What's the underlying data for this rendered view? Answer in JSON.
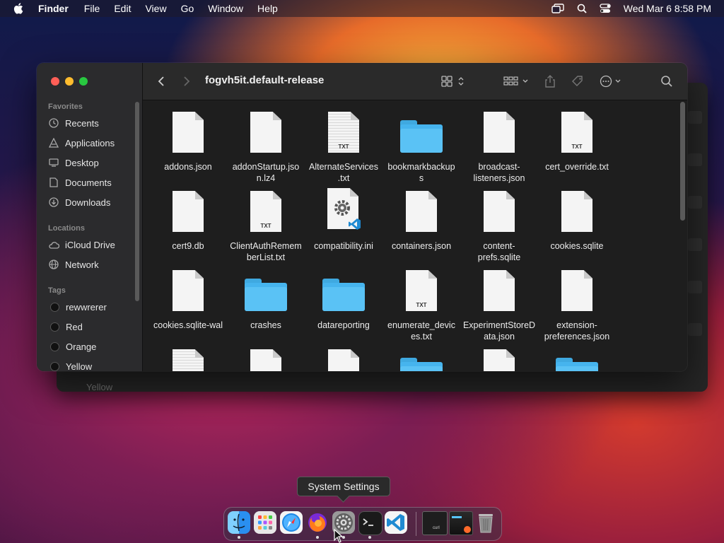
{
  "menubar": {
    "app_name": "Finder",
    "menus": [
      "File",
      "Edit",
      "View",
      "Go",
      "Window",
      "Help"
    ],
    "clock": "Wed Mar 6  8:58 PM"
  },
  "finder": {
    "title": "fogvh5it.default-release",
    "sidebar": {
      "favorites_title": "Favorites",
      "favorites": [
        {
          "label": "Recents",
          "icon": "clock-icon"
        },
        {
          "label": "Applications",
          "icon": "applications-icon"
        },
        {
          "label": "Desktop",
          "icon": "desktop-icon"
        },
        {
          "label": "Documents",
          "icon": "document-icon"
        },
        {
          "label": "Downloads",
          "icon": "download-icon"
        }
      ],
      "locations_title": "Locations",
      "locations": [
        {
          "label": "iCloud Drive",
          "icon": "cloud-icon"
        },
        {
          "label": "Network",
          "icon": "globe-icon"
        }
      ],
      "tags_title": "Tags",
      "tags": [
        {
          "label": "rewwrerer"
        },
        {
          "label": "Red"
        },
        {
          "label": "Orange"
        },
        {
          "label": "Yellow"
        }
      ]
    },
    "files": [
      {
        "name": "addons.json",
        "kind": "doc"
      },
      {
        "name": "addonStartup.jso\nn.lz4",
        "kind": "doc"
      },
      {
        "name": "AlternateServices\n.txt",
        "kind": "txt-lined"
      },
      {
        "name": "bookmarkbackup\ns",
        "kind": "folder"
      },
      {
        "name": "broadcast-\nlisteners.json",
        "kind": "doc"
      },
      {
        "name": "cert_override.txt",
        "kind": "txt"
      },
      {
        "name": "cert9.db",
        "kind": "doc"
      },
      {
        "name": "ClientAuthRemem\nberList.txt",
        "kind": "txt"
      },
      {
        "name": "compatibility.ini",
        "kind": "settings"
      },
      {
        "name": "containers.json",
        "kind": "doc"
      },
      {
        "name": "content-\nprefs.sqlite",
        "kind": "doc"
      },
      {
        "name": "cookies.sqlite",
        "kind": "doc"
      },
      {
        "name": "cookies.sqlite-wal",
        "kind": "doc"
      },
      {
        "name": "crashes",
        "kind": "folder"
      },
      {
        "name": "datareporting",
        "kind": "folder"
      },
      {
        "name": "enumerate_devic\nes.txt",
        "kind": "txt"
      },
      {
        "name": "ExperimentStoreD\nata.json",
        "kind": "doc"
      },
      {
        "name": "extension-\npreferences.json",
        "kind": "doc"
      },
      {
        "name": "",
        "kind": "doc-lined"
      },
      {
        "name": "",
        "kind": "doc"
      },
      {
        "name": "",
        "kind": "doc"
      },
      {
        "name": "",
        "kind": "folder"
      },
      {
        "name": "",
        "kind": "doc"
      },
      {
        "name": "",
        "kind": "folder"
      }
    ],
    "txt_badge": "TXT"
  },
  "back_window": {
    "ghost_label": "Yellow"
  },
  "tooltip": "System Settings",
  "dock": {
    "apps": [
      {
        "name": "finder",
        "running": true
      },
      {
        "name": "launchpad",
        "running": false
      },
      {
        "name": "safari",
        "running": false
      },
      {
        "name": "firefox",
        "running": true
      },
      {
        "name": "system-settings",
        "running": true
      },
      {
        "name": "terminal",
        "running": true
      },
      {
        "name": "vscode",
        "running": false
      }
    ],
    "thumb_label": "curl"
  },
  "colors": {
    "folder": "#46b4ee",
    "traffic_close": "#ff5f57",
    "traffic_min": "#febc2e",
    "traffic_max": "#28c840"
  }
}
